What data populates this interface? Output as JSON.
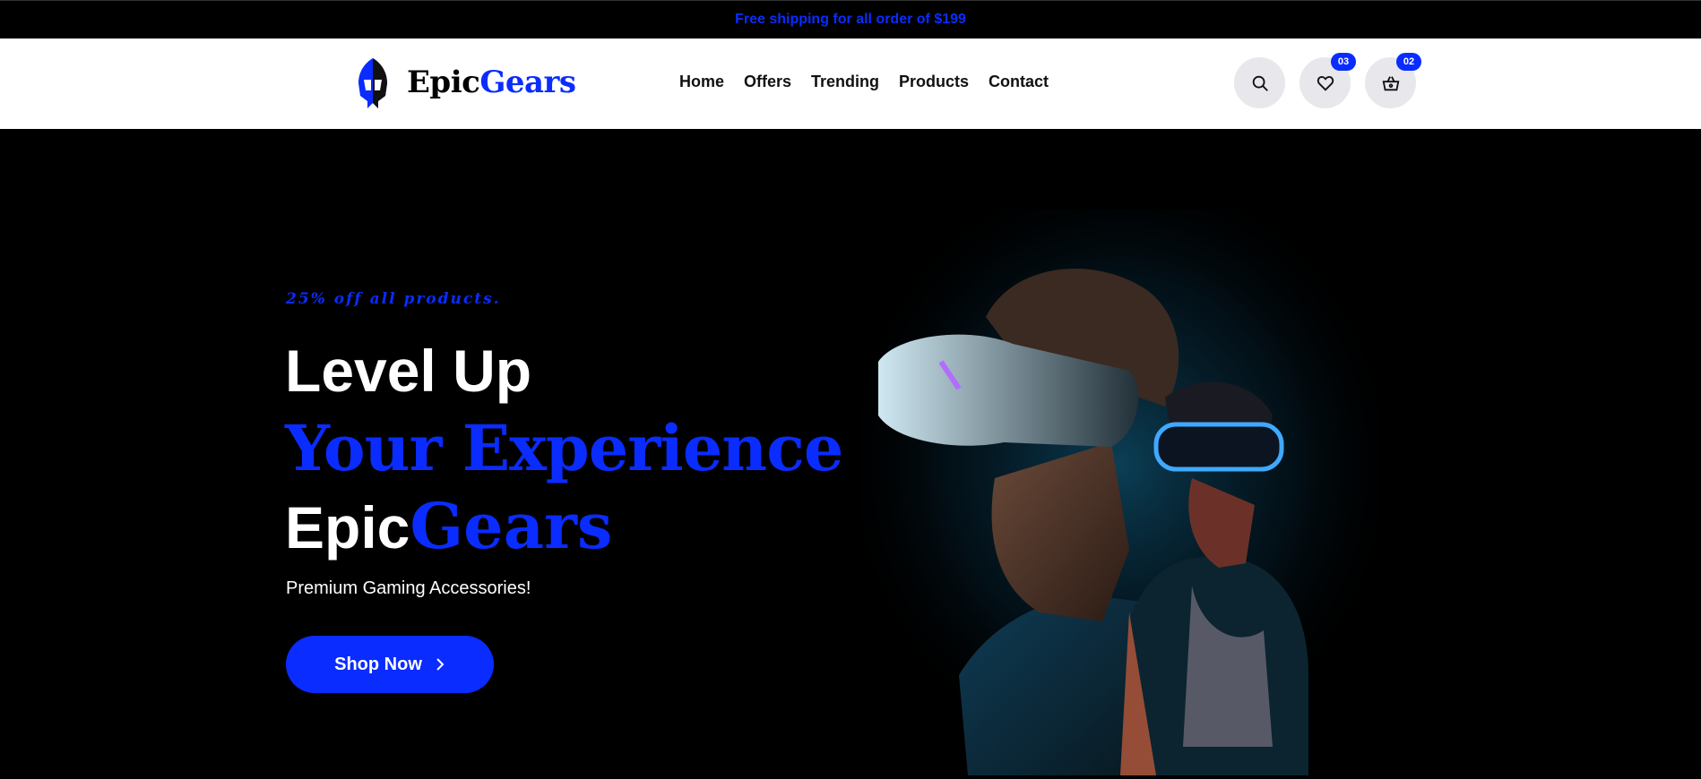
{
  "announcement": {
    "text": "Free shipping for all order of $199"
  },
  "brand": {
    "name_part1": "Epic",
    "name_part2": "Gears"
  },
  "nav": {
    "items": [
      {
        "label": "Home"
      },
      {
        "label": "Offers"
      },
      {
        "label": "Trending"
      },
      {
        "label": "Products"
      },
      {
        "label": "Contact"
      }
    ]
  },
  "header_actions": {
    "search_icon": "search-icon",
    "wishlist": {
      "icon": "heart-icon",
      "count": "03"
    },
    "cart": {
      "icon": "basket-icon",
      "count": "02"
    }
  },
  "hero": {
    "tagline": "25% off all products.",
    "line1": "Level Up",
    "line2": "Your Experience",
    "line3_part1": "Epic",
    "line3_part2": "Gears",
    "subtitle": "Premium Gaming Accessories!",
    "cta_label": "Shop Now",
    "cta_icon": "chevron-right-icon",
    "image": "vr-gamers-illustration"
  },
  "colors": {
    "accent": "#0a2cff",
    "background": "#000000",
    "header_bg": "#ffffff",
    "icon_button_bg": "#e7e7ec"
  }
}
